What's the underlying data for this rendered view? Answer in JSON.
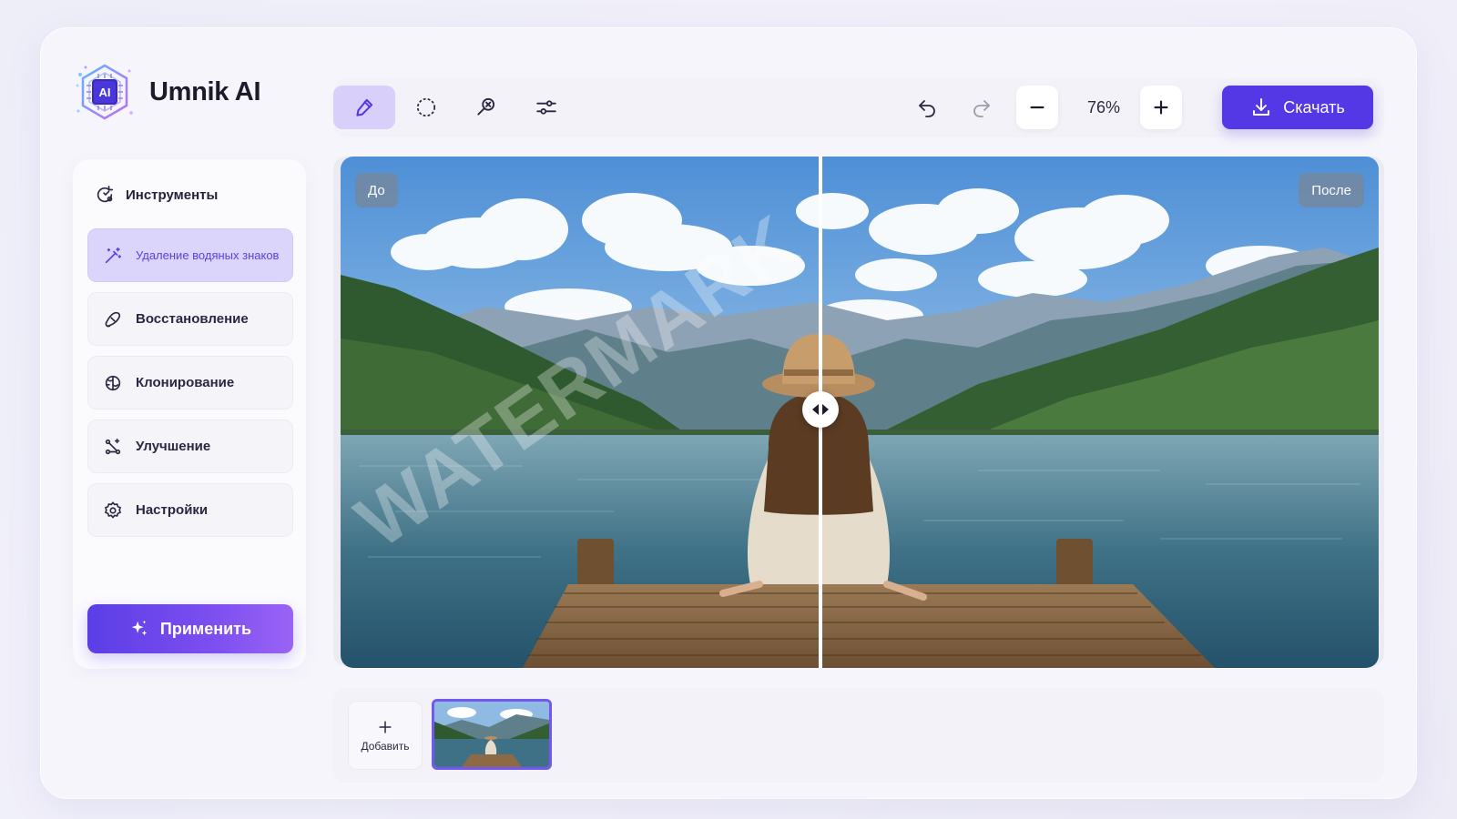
{
  "app": {
    "name": "Umnik AI",
    "logo_badge": "AI"
  },
  "sidebar": {
    "title": "Инструменты",
    "items": [
      {
        "label": "Удаление водяных знаков",
        "icon": "magic-wand-icon",
        "active": true
      },
      {
        "label": "Восстановление",
        "icon": "bandage-icon",
        "active": false
      },
      {
        "label": "Клонирование",
        "icon": "clone-stamp-icon",
        "active": false
      },
      {
        "label": "Улучшение",
        "icon": "sparkle-nodes-icon",
        "active": false
      },
      {
        "label": "Настройки",
        "icon": "gear-icon",
        "active": false
      }
    ],
    "apply_label": "Применить"
  },
  "toolbar": {
    "tools": [
      "brush-icon",
      "lasso-icon",
      "magic-select-icon",
      "sliders-icon"
    ],
    "zoom": "76%",
    "download_label": "Скачать"
  },
  "canvas": {
    "before_label": "До",
    "after_label": "После",
    "watermark_text": "WATERMARK",
    "split_position": 0.47
  },
  "thumbs": {
    "add_label": "Добавить"
  },
  "colors": {
    "accent": "#5437e5",
    "accent_light": "#dcd5fb"
  }
}
